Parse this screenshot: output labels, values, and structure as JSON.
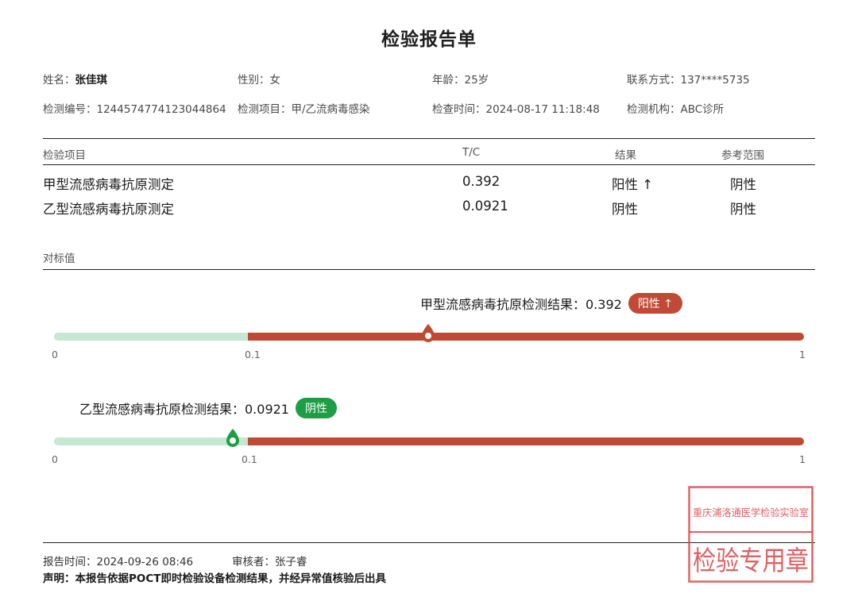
{
  "title": "检验报告单",
  "patient": {
    "name_label": "姓名：",
    "name": "张佳琪",
    "gender": "性别：女",
    "age": "年龄：25岁",
    "contact": "联系方式：137****5735",
    "test_id": "检测编号：1244574774123044864",
    "test_item": "检测项目：甲/乙流病毒感染",
    "test_time": "检查时间：2024-08-17 11:18:48",
    "institution": "检测机构：ABC诊所"
  },
  "table": {
    "headers": [
      "检验项目",
      "T/C",
      "结果",
      "参考范围"
    ],
    "rows": [
      [
        "甲型流感病毒抗原测定",
        "0.392",
        "阳性 ↑",
        "阴性"
      ],
      [
        "乙型流感病毒抗原测定",
        "0.0921",
        "阴性",
        "阴性"
      ]
    ]
  },
  "section_label": "对标值",
  "gauges": [
    {
      "label": "甲型流感病毒抗原检测结果：0.392",
      "badge": "阳性 ↑",
      "status": "positive",
      "value": 0.392,
      "ticks": [
        "0",
        "0.1",
        "1"
      ]
    },
    {
      "label": "乙型流感病毒抗原检测结果：0.0921",
      "badge": "阴性",
      "status": "negative",
      "value": 0.0921,
      "ticks": [
        "0",
        "0.1",
        "1"
      ]
    }
  ],
  "footer": {
    "report_time": "报告时间：2024-09-26  08:46",
    "reviewer": "审核者：张子睿",
    "statement": "声明：本报告依据POCT即时检验设备检测结果，并经异常值核验后出具"
  },
  "stamp": {
    "top_text": "重庆浦洛通医学检验实验室",
    "bottom_text": "检验专用章"
  },
  "colors": {
    "negative": "#c4e8d2",
    "positive": "#bf4a33",
    "badge_positive": "#c04a35",
    "badge_negative": "#1e9e44"
  }
}
